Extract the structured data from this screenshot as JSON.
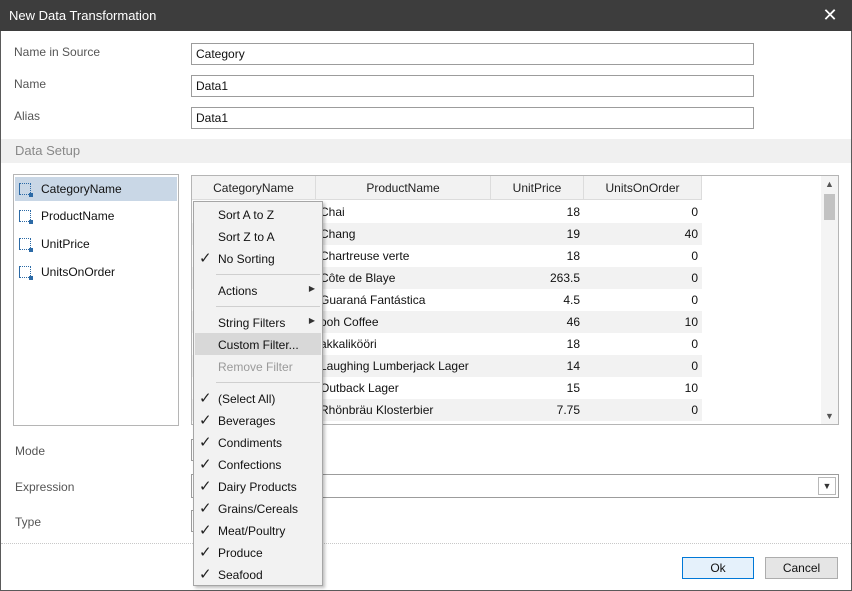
{
  "window": {
    "title": "New Data Transformation",
    "close_glyph": "✕"
  },
  "form": {
    "name_in_source_label": "Name in Source",
    "name_in_source_value": "Category",
    "name_label": "Name",
    "name_value": "Data1",
    "alias_label": "Alias",
    "alias_value": "Data1",
    "mode_label": "Mode",
    "expression_label": "Expression",
    "type_label": "Type"
  },
  "section": {
    "title": "Data Setup"
  },
  "fields": [
    {
      "label": "CategoryName",
      "icon": "column-field-icon",
      "selected": true
    },
    {
      "label": "ProductName",
      "icon": "column-field-icon",
      "selected": false
    },
    {
      "label": "UnitPrice",
      "icon": "column-field-icon",
      "selected": false
    },
    {
      "label": "UnitsOnOrder",
      "icon": "column-field-icon",
      "selected": false
    }
  ],
  "grid": {
    "columns": [
      "CategoryName",
      "ProductName",
      "UnitPrice",
      "UnitsOnOrder"
    ],
    "rows": [
      {
        "product": "Chai",
        "price": "18",
        "units": "0"
      },
      {
        "product": "Chang",
        "price": "19",
        "units": "40"
      },
      {
        "product": "Chartreuse verte",
        "price": "18",
        "units": "0"
      },
      {
        "product": "Côte de Blaye",
        "price": "263.5",
        "units": "0"
      },
      {
        "product": "Guaraná Fantástica",
        "price": "4.5",
        "units": "0"
      },
      {
        "product": "ooh Coffee",
        "price": "46",
        "units": "10"
      },
      {
        "product": "akkalikööri",
        "price": "18",
        "units": "0"
      },
      {
        "product": "Laughing Lumberjack Lager",
        "price": "14",
        "units": "0"
      },
      {
        "product": "Outback Lager",
        "price": "15",
        "units": "10"
      },
      {
        "product": "Rhönbräu Klosterbier",
        "price": "7.75",
        "units": "0"
      }
    ]
  },
  "menu": {
    "sort_a_z": "Sort A to Z",
    "sort_z_a": "Sort Z to A",
    "no_sorting": "No Sorting",
    "actions": "Actions",
    "string_filters": "String Filters",
    "custom_filter": "Custom Filter...",
    "remove_filter": "Remove Filter",
    "select_all": "(Select All)",
    "categories": [
      "Beverages",
      "Condiments",
      "Confections",
      "Dairy Products",
      "Grains/Cereals",
      "Meat/Poultry",
      "Produce",
      "Seafood"
    ]
  },
  "buttons": {
    "ok": "Ok",
    "cancel": "Cancel"
  },
  "colors": {
    "titlebar": "#3d3d3d",
    "selection": "#c9d7e6",
    "accent": "#0078d7"
  }
}
